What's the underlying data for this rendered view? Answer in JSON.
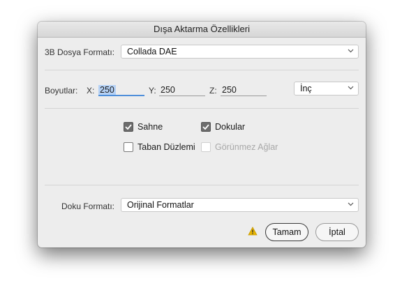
{
  "dialog": {
    "title": "Dışa Aktarma Özellikleri",
    "format_label": "3B Dosya Formatı:",
    "format_value": "Collada DAE",
    "dimensions_label": "Boyutlar:",
    "x_label": "X:",
    "x_value": "250",
    "y_label": "Y:",
    "y_value": "250",
    "z_label": "Z:",
    "z_value": "250",
    "unit_value": "İnç",
    "checkboxes": [
      {
        "label": "Sahne",
        "checked": true,
        "enabled": true
      },
      {
        "label": "Dokular",
        "checked": true,
        "enabled": true
      },
      {
        "label": "Taban Düzlemi",
        "checked": false,
        "enabled": true
      },
      {
        "label": "Görünmez Ağlar",
        "checked": false,
        "enabled": false
      }
    ],
    "texture_label": "Doku Formatı:",
    "texture_value": "Orijinal Formatlar",
    "ok_label": "Tamam",
    "cancel_label": "İptal"
  },
  "icons": {
    "warning": "warning-icon",
    "chevron": "chevron-down-icon",
    "check": "check-icon"
  },
  "colors": {
    "focus_accent": "#4f8fda",
    "warning": "#e8b400"
  }
}
